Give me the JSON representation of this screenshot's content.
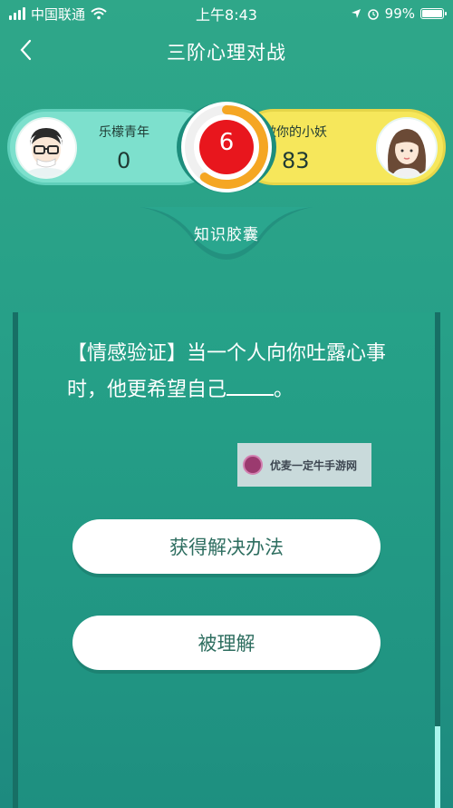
{
  "status_bar": {
    "carrier": "中国联通",
    "time": "上午8:43",
    "battery": "99%",
    "battery_level": 0.99
  },
  "nav": {
    "title": "三阶心理对战",
    "back_icon": "chevron-left-icon"
  },
  "battle": {
    "left_player": {
      "name": "乐檬青年",
      "score": "0"
    },
    "right_player": {
      "name": "做你的小妖",
      "score": "83"
    },
    "timer": {
      "value": "6",
      "progress": 0.6,
      "ring_color": "#f5a623",
      "disc_color": "#e8161d"
    }
  },
  "category": "知识胶囊",
  "question": {
    "text_before": "【情感验证】当一个人向你吐露心事时，他更希望自己",
    "text_after": "。"
  },
  "watermark": "优麦一定牛手游网",
  "answers": [
    {
      "label": "获得解决办法"
    },
    {
      "label": "被理解"
    }
  ],
  "colors": {
    "background": "#27a088",
    "left_player": "#7de0cd",
    "right_player": "#f6e75b"
  }
}
